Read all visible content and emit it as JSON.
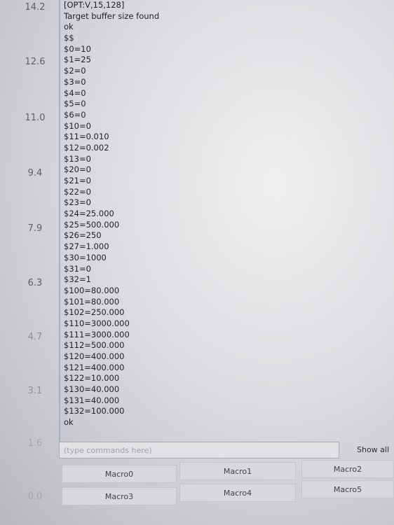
{
  "axis": {
    "ticks": [
      "14.2",
      "12.6",
      "11.0",
      "9.4",
      "7.9",
      "6.3",
      "4.7",
      "3.1",
      "1.6",
      "0.0"
    ]
  },
  "console": {
    "lines": [
      "[OPT:V,15,128]",
      "Target buffer size found",
      "ok",
      "$$",
      "$0=10",
      "$1=25",
      "$2=0",
      "$3=0",
      "$4=0",
      "$5=0",
      "$6=0",
      "$10=0",
      "$11=0.010",
      "$12=0.002",
      "$13=0",
      "$20=0",
      "$21=0",
      "$22=0",
      "$23=0",
      "$24=25.000",
      "$25=500.000",
      "$26=250",
      "$27=1.000",
      "$30=1000",
      "$31=0",
      "$32=1",
      "$100=80.000",
      "$101=80.000",
      "$102=250.000",
      "$110=3000.000",
      "$111=3000.000",
      "$112=500.000",
      "$120=400.000",
      "$121=400.000",
      "$122=10.000",
      "$130=40.000",
      "$131=40.000",
      "$132=100.000",
      "ok"
    ]
  },
  "command": {
    "placeholder": "(type commands here)",
    "show_all_label": "Show all"
  },
  "macros": {
    "m0": "Macro0",
    "m1": "Macro1",
    "m2": "Macro2",
    "m3": "Macro3",
    "m4": "Macro4",
    "m5": "Macro5"
  }
}
